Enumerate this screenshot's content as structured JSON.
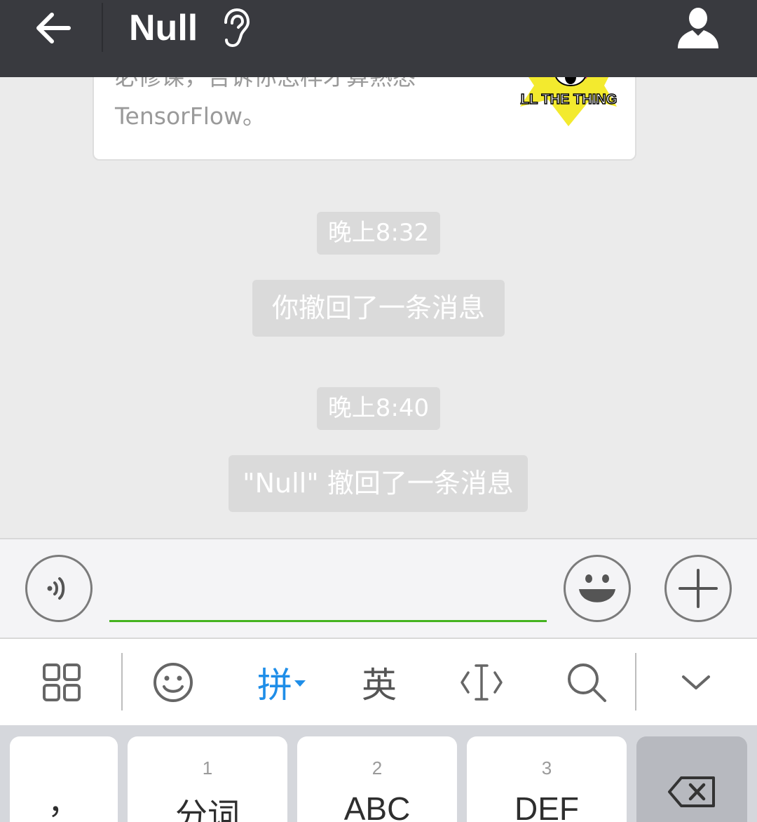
{
  "header": {
    "title": "Null",
    "icons": {
      "back": "back-arrow-icon",
      "earpiece": "ear-icon",
      "profile": "person-icon"
    }
  },
  "chat": {
    "article": {
      "desc_line1": "必修课，告诉你怎样才算熟悉",
      "desc_line2": "TensorFlow。",
      "thumb_text": "ALL THE THINGS"
    },
    "messages": [
      {
        "type": "time",
        "text": "晚上8:32"
      },
      {
        "type": "system",
        "text": "你撤回了一条消息"
      },
      {
        "type": "time",
        "text": "晚上8:40"
      },
      {
        "type": "system",
        "text": "\"Null\" 撤回了一条消息"
      }
    ]
  },
  "input_bar": {
    "voice_icon": "voice-icon",
    "input_value": "",
    "emoji_icon": "smiley-icon",
    "more_icon": "plus-icon",
    "accent_color": "#45b31f"
  },
  "ime_toolbar": {
    "grid_icon": "grid-icon",
    "emoji_icon": "smiley-icon",
    "pinyin_label": "拼",
    "english_label": "英",
    "cursor_icon": "cursor-icon",
    "search_icon": "search-icon",
    "collapse_icon": "chevron-down-icon",
    "active_color": "#1f8ee8"
  },
  "keyboard": {
    "keys": [
      {
        "num": "",
        "label": "，"
      },
      {
        "num": "1",
        "label": "分词"
      },
      {
        "num": "2",
        "label": "ABC"
      },
      {
        "num": "3",
        "label": "DEF"
      }
    ],
    "delete_icon": "backspace-icon"
  }
}
